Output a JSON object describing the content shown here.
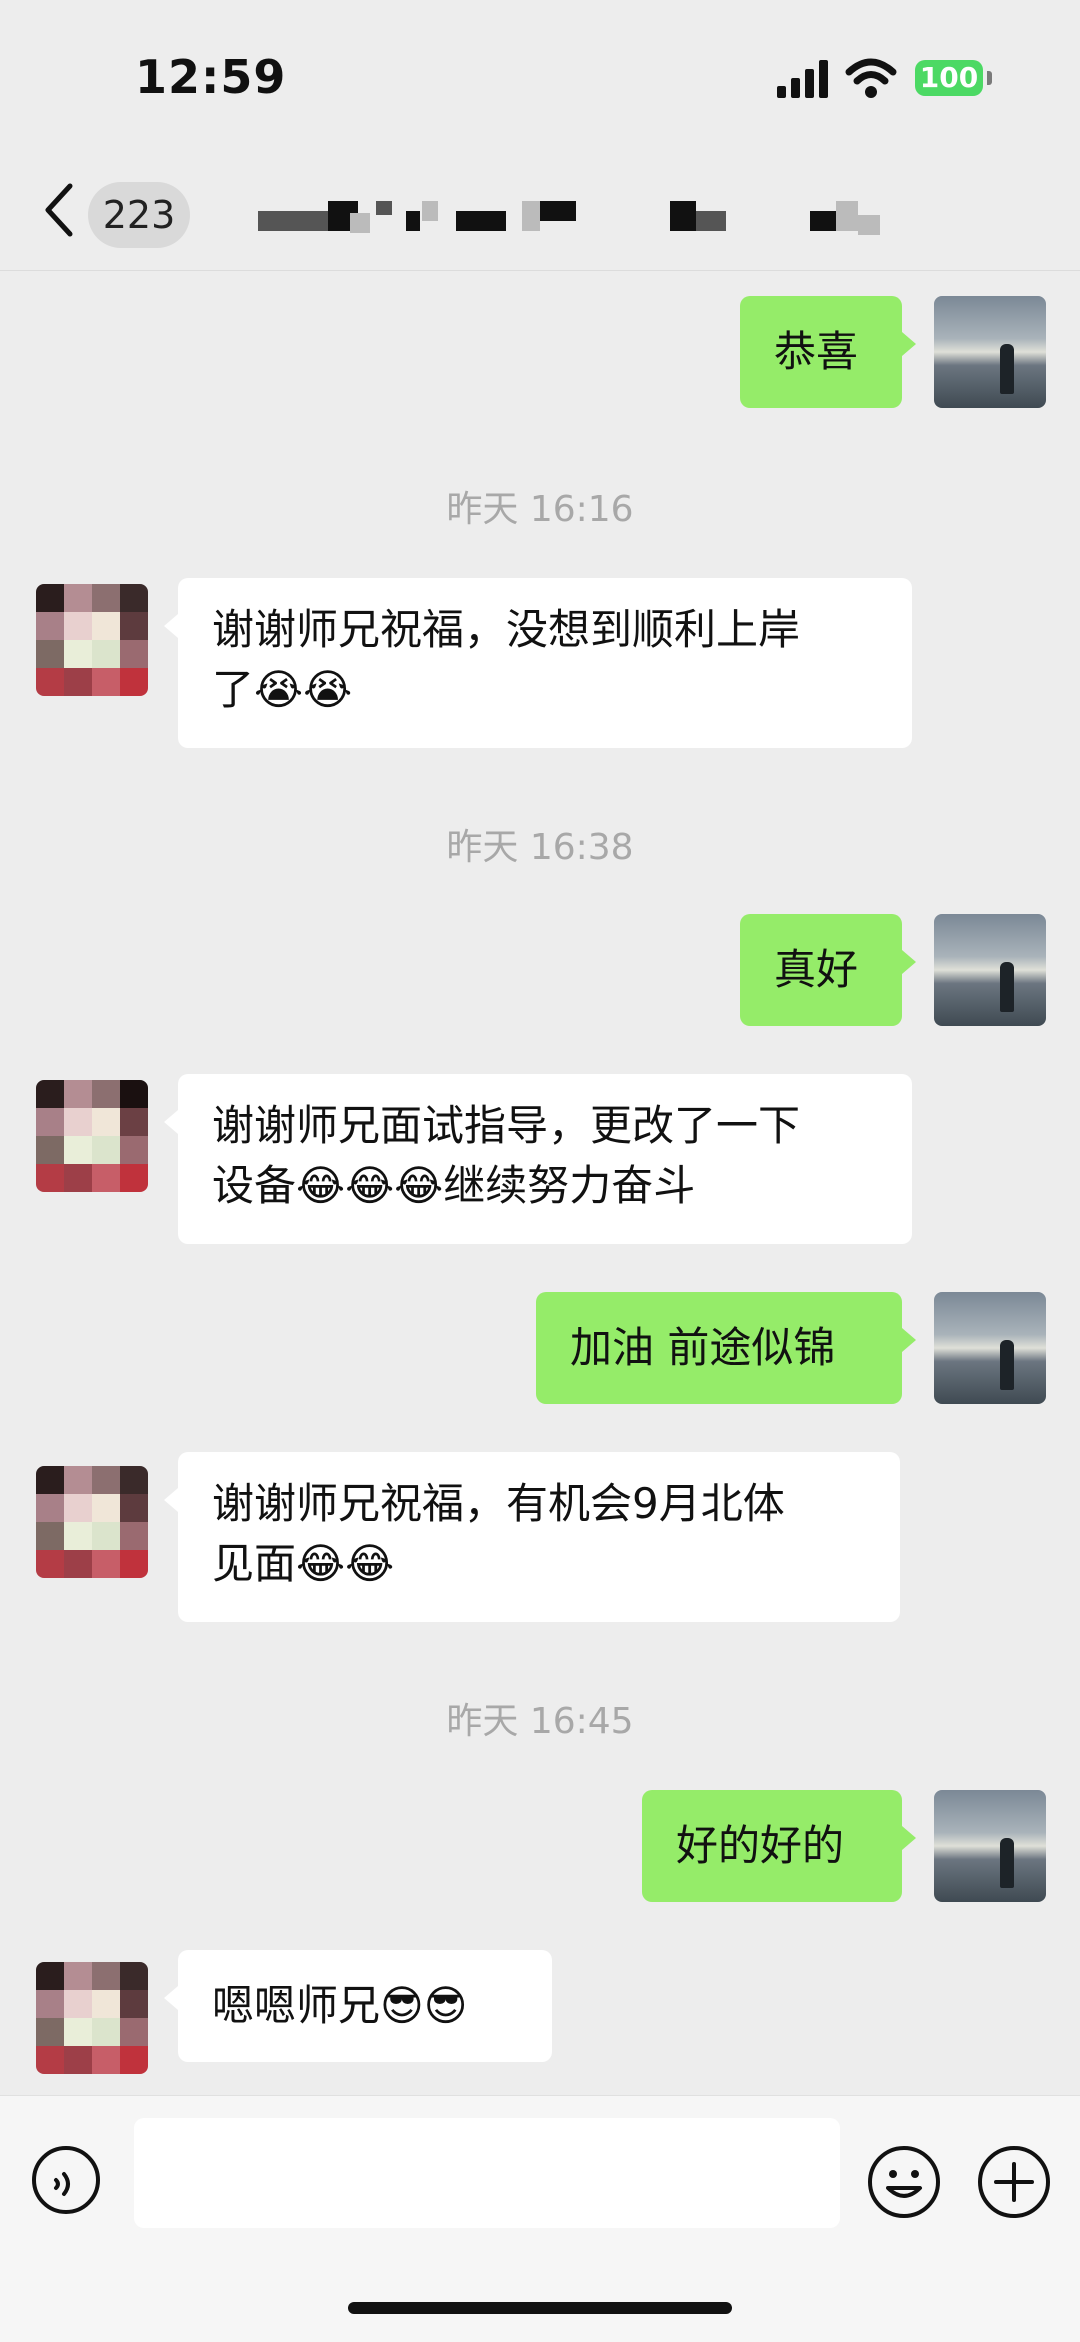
{
  "status_bar": {
    "time": "12:59",
    "battery": "100"
  },
  "nav": {
    "unread_count": "223"
  },
  "messages": [
    {
      "type": "out",
      "text": "恭喜"
    },
    {
      "type": "time",
      "text": "昨天 16:16"
    },
    {
      "type": "in",
      "text": "谢谢师兄祝福，没想到顺利上岸\n了😭😭"
    },
    {
      "type": "time",
      "text": "昨天 16:38"
    },
    {
      "type": "out",
      "text": "真好"
    },
    {
      "type": "in",
      "text": "谢谢师兄面试指导，更改了一下\n设备😂😂😂继续努力奋斗"
    },
    {
      "type": "out",
      "text": "加油 前途似锦"
    },
    {
      "type": "in",
      "text": "谢谢师兄祝福，有机会9月北体\n见面😂😂"
    },
    {
      "type": "time",
      "text": "昨天 16:45"
    },
    {
      "type": "out",
      "text": "好的好的"
    },
    {
      "type": "in",
      "text": "嗯嗯师兄😎😎"
    }
  ],
  "input": {
    "placeholder": ""
  },
  "colors": {
    "outgoing_bubble": "#95ec69",
    "incoming_bubble": "#ffffff",
    "background": "#ededed",
    "battery": "#4cd964"
  }
}
